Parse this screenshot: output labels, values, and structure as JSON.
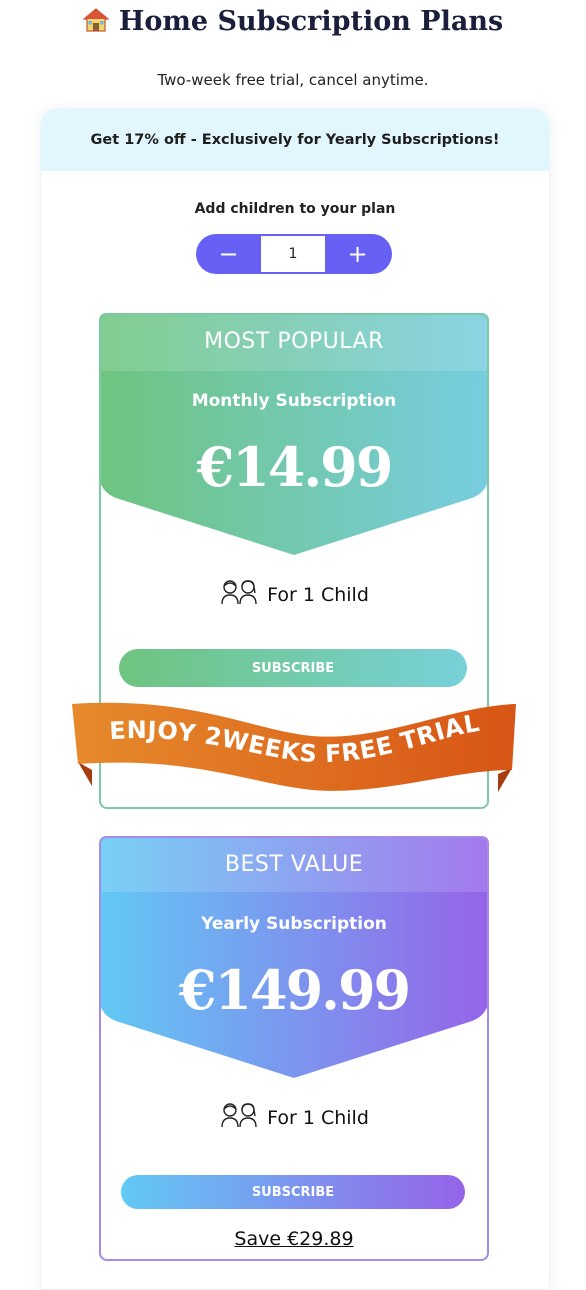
{
  "header": {
    "title": "Home Subscription Plans",
    "subtitle": "Two-week free trial, cancel anytime."
  },
  "promo": {
    "text": "Get 17% off - Exclusively for Yearly Subscriptions!"
  },
  "children": {
    "label": "Add children to your plan",
    "quantity": "1",
    "minus_label": "−",
    "plus_label": "+"
  },
  "plans": [
    {
      "badge": "MOST POPULAR",
      "name": "Monthly Subscription",
      "price": "€14.99",
      "for_child": "For 1 Child",
      "subscribe_label": "SUBSCRIBE",
      "gradient_from": "#6ec47f",
      "gradient_to": "#77cde0"
    },
    {
      "badge": "BEST VALUE",
      "name": "Yearly Subscription",
      "price": "€149.99",
      "for_child": "For 1 Child",
      "subscribe_label": "SUBSCRIBE",
      "save_label": "Save €29.89",
      "gradient_from": "#62c9f4",
      "gradient_to": "#9563e9"
    }
  ],
  "ribbon": {
    "text": "ENJOY 2WEEKS FREE TRIAL",
    "color": "#e06a22"
  },
  "icons": {
    "house": "house-icon",
    "children": "children-icon"
  }
}
